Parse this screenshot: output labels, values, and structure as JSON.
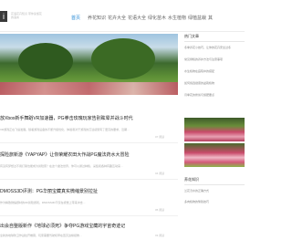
{
  "header": {
    "logo_mark": "i",
    "logo_sub": "花语花卉知识 带你读懂花的语言",
    "nav": [
      "首页",
      "养花知识",
      "花卉大全",
      "花语大全",
      "绿化苗木",
      "水生植物",
      "绿植盆栽",
      "其"
    ]
  },
  "articles": [
    {
      "title": "放Xbox新手舞蹈VR加速器，PG拳击玫瑰玩家告别眩晕并战斗时代",
      "excerpt": "VR游戏正在飞速发展。随着游戏设备的不断升级优化，体验者对于游戏的沉浸感受有了更高的要求，近期…",
      "meta": "07 阅读"
    },
    {
      "title": "探险旅新游《YAPYAP》让你荣耀农田大作战PG魔法药水大冒险",
      "excerpt": "有没有梦想过不用打架也能成为冒险家？在这个魔法世界，你可以通过种植、采集和各种有趣互动来…",
      "meta": "04 阅读"
    },
    {
      "title": "DMOSS3D评测：PG华丽宝藏真实微缩景别拉扯",
      "excerpt": "作为精致微缩题材的3D冒险游戏，DMOSS3D不仅在视觉上带来冲击…",
      "meta": "05 阅读"
    },
    {
      "title": "出会自整版新作《地球必须死》争夺PG游戏宝藏的宇宙奇迹记",
      "excerpt": "全新的地球防卫作战拉开帷幕，玩家需要驾驶机甲在毁灭边缘拯救…",
      "meta": "03 阅读"
    }
  ],
  "sidebar": {
    "box1_title": "热门文章",
    "box1_links": [
      "冬季养花小技巧，让你的花卉安全过冬",
      "常见绿植的养护方法与注意事项",
      "水生植物在庭院中的搭配",
      "如何挑选健康的盆栽植物",
      "月季花的修剪与施肥要点"
    ],
    "box2_title": "养花知识",
    "box2_links": [
      "兰花浇水的正确方式",
      "多肉植物的繁殖技巧"
    ]
  }
}
